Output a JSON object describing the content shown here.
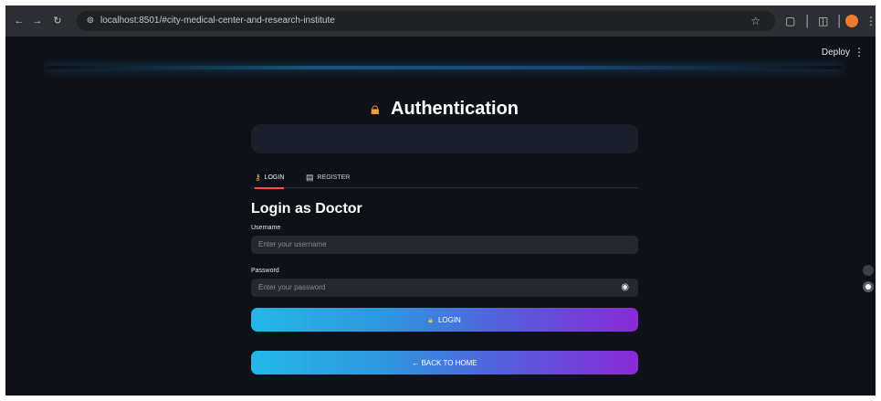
{
  "browser": {
    "url": "localhost:8501/#city-medical-center-and-research-institute",
    "back_icon": "arrow-left-icon",
    "forward_icon": "arrow-right-icon",
    "reload_icon": "reload-icon"
  },
  "app": {
    "deploy_label": "Deploy",
    "menu_glyph": "⋮",
    "title": "Authentication",
    "title_icon": "lock-icon",
    "tabs": [
      {
        "label": "LOGIN",
        "icon": "key-icon",
        "active": true
      },
      {
        "label": "REGISTER",
        "icon": "document-icon",
        "active": false
      }
    ],
    "heading": "Login as Doctor",
    "username": {
      "label": "Username",
      "placeholder": "Enter your username"
    },
    "password": {
      "label": "Password",
      "placeholder": "Enter your password"
    },
    "login_button": {
      "label": "LOGIN",
      "icon": "lock-icon"
    },
    "home_button": {
      "label": "← BACK TO HOME"
    }
  },
  "colors": {
    "background": "#0e1117",
    "input_bg": "#262730",
    "tab_accent": "#ff4b4b",
    "button_gradient_start": "#22b8e6",
    "button_gradient_end": "#8a2ad8"
  }
}
